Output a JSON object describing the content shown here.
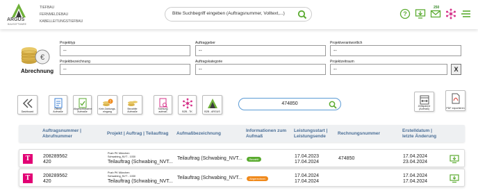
{
  "brand": {
    "name": "ARGUS",
    "sub": "BAUSOFTWARE",
    "menu": [
      "TIEFBAU",
      "FERNMELDEBAU",
      "KABELLEITUNGSTIEFBAU"
    ]
  },
  "header": {
    "search_placeholder": "Bitte Suchbegriff eingeben (Auftragsnummer, Volltext,...)",
    "mail_count": "250"
  },
  "page": {
    "title": "Abrechnung"
  },
  "form": {
    "projekttyp": {
      "label": "Projekttyp",
      "value": "--"
    },
    "auftraggeber": {
      "label": "Auftraggeber",
      "value": "--"
    },
    "projektverantwortlich": {
      "label": "Projektverantwortlich",
      "value": "--"
    },
    "projektbezeichnung": {
      "label": "Projektbezeichnung",
      "value": "--"
    },
    "auftragskategorie": {
      "label": "Auftragskategorie",
      "value": "--"
    },
    "projektzeitraum": {
      "label": "Projektzeitraum",
      "value": "--"
    },
    "clear_label": "X"
  },
  "toolbar": {
    "dashboard": "Dashboard",
    "offene": "Offene Aufmaße",
    "abgeschlossene": "Abgeschlossene Aufmaße",
    "kein_zahlung": "Kein Zahlungs-eingang",
    "bezahlte": "Bezahlte Aufmaße",
    "sichtung": "Sichtung aufmaß",
    "b2b_tk": "B2B - TK",
    "b2b_argus": "B2B - ARGUS",
    "filter_value": "474850",
    "zeitspanne": "Zeitspanne (Aufmaß)",
    "pdf": "PDF exportieren"
  },
  "table": {
    "headers": {
      "auftragsnummer": "Auftragsnummer | Abrufnummer",
      "projekt": "Projekt | Auftrag | Teilauftrag",
      "aufmass": "Aufmaßbezeichnung",
      "info": "Informationen zum Aufmaß",
      "leistung": "Leistungsstart | Leistungsende",
      "rechnung": "Rechnungsnummer",
      "erstellt": "Erstelldatum | letzte Änderung"
    },
    "rows": [
      {
        "auftragsnummer": "208289562",
        "abrufnummer": "420",
        "projekt_l1": "Push PK München",
        "projekt_l2": "Schwabing_NVT - 1030",
        "teilauftrag": "Teilauftrag (Schwabing_NVT...",
        "aufmass": "Teilauftrag (Schwabing_NVT...",
        "status": "Bezahlt",
        "status_color": "#5aab2f",
        "start": "17.04.2023",
        "end": "17.04.2024",
        "rechnung": "474850",
        "erstellt": "17.04.2024",
        "geaendert": "23.04.2024"
      },
      {
        "auftragsnummer": "208289562",
        "abrufnummer": "420",
        "projekt_l1": "Push PK München",
        "projekt_l2": "Schwabing_NVT - 1030",
        "teilauftrag": "Teilauftrag (Schwabing_NVT...",
        "aufmass": "Teilauftrag (Schwabing_NVT...",
        "status": "Abgerechnet",
        "status_color": "#f08a1c",
        "start": "17.04.2024",
        "end": "17.04.2024",
        "rechnung": "",
        "erstellt": "17.04.2024",
        "geaendert": "17.04.2024"
      }
    ]
  },
  "colors": {
    "accent_green": "#5aab2f",
    "accent_magenta": "#d6338a",
    "link_blue": "#4a6e96"
  }
}
